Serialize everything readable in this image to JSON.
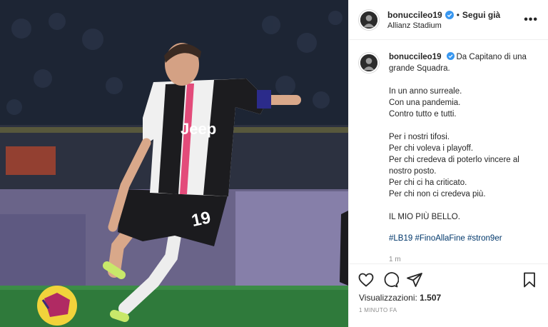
{
  "post": {
    "username": "bonuccileo19",
    "follow_label": "Segui già",
    "separator": "•",
    "location": "Allianz Stadium",
    "more_label": "•••",
    "caption": {
      "first_line": "Da Capitano di una grande Squadra.",
      "block1": [
        "In un anno surreale.",
        "Con una pandemia.",
        "Contro tutto e tutti."
      ],
      "block2": [
        "Per i nostri tifosi.",
        "Per chi voleva i playoff.",
        "Per chi credeva di poterlo vincere al nostro posto.",
        "Per chi ci ha criticato.",
        "Per chi non ci credeva più."
      ],
      "block3": "IL MIO PIÙ BELLO.",
      "hashtags": "#LB19 #FinoAllaFine #stron9er",
      "time_short": "1 m"
    },
    "views_label": "Visualizzazioni:",
    "views_count": "1.507",
    "time_ago": "1 MINUTO FA"
  },
  "photo": {
    "shirt_sponsor": "Jeep",
    "shirt_number": "19"
  },
  "icons": {
    "verified": "verified-badge-icon",
    "like": "heart-icon",
    "comment": "comment-bubble-icon",
    "share": "paper-plane-icon",
    "save": "bookmark-icon",
    "more": "more-options-icon"
  },
  "colors": {
    "verified": "#3897f0",
    "hashtag": "#00376b",
    "muted": "#8e8e8e",
    "text": "#262626"
  }
}
